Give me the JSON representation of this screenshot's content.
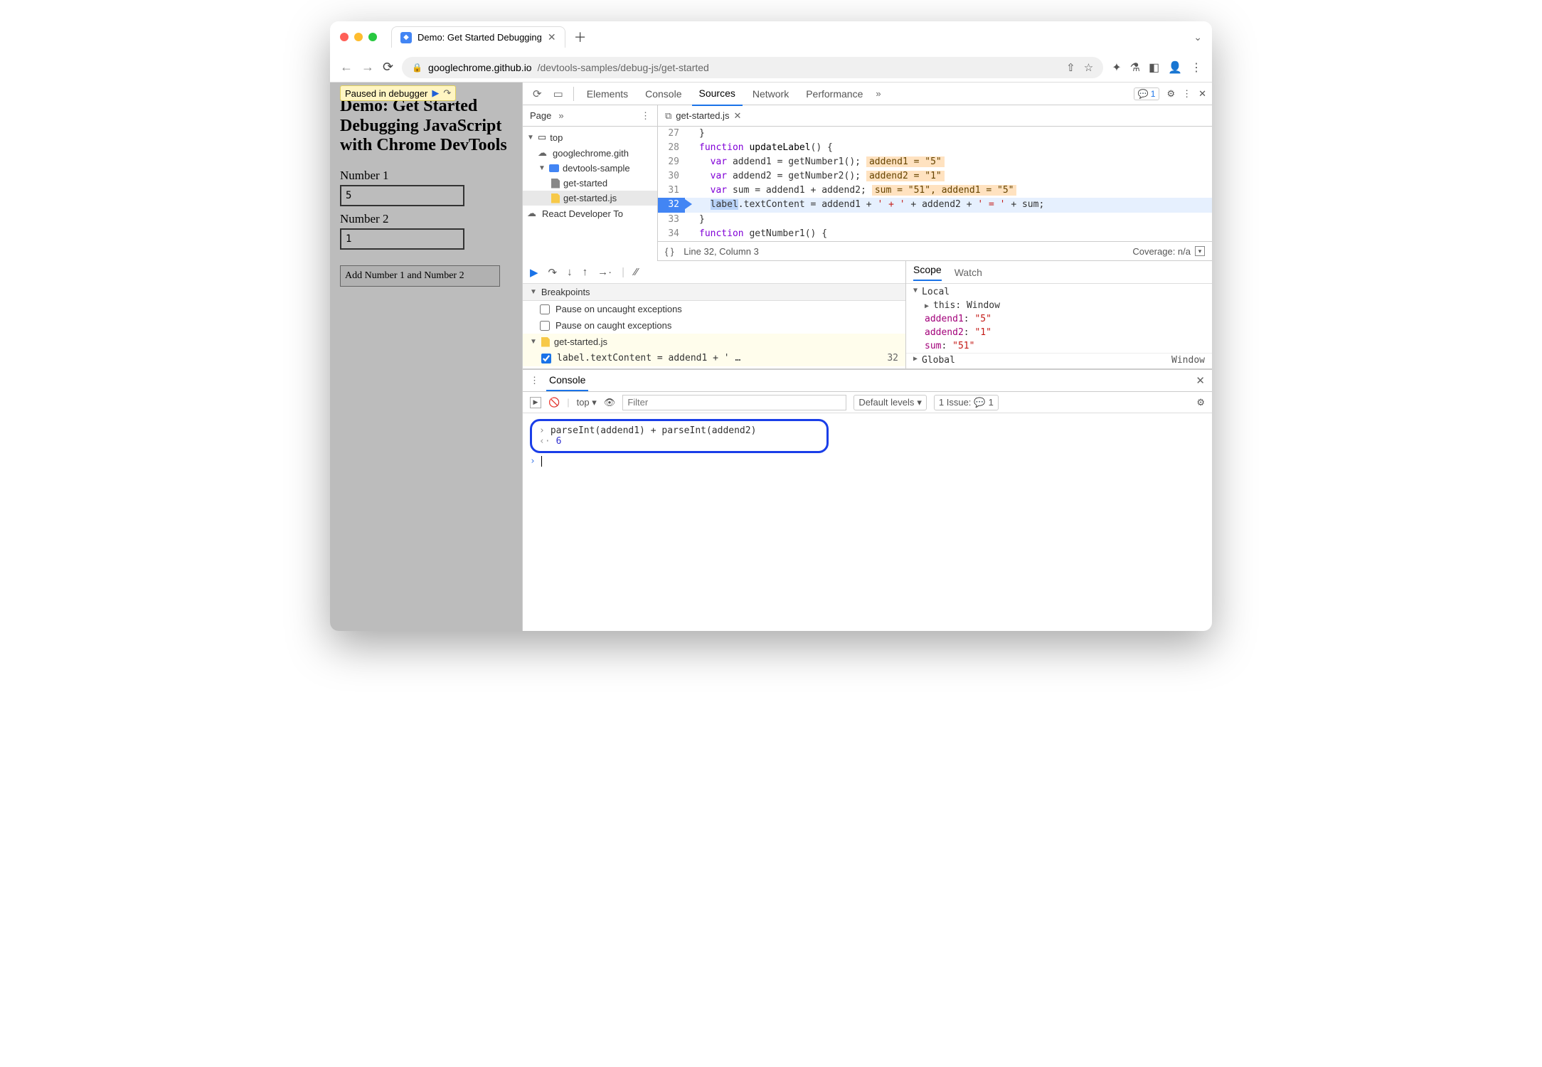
{
  "browser": {
    "tab_title": "Demo: Get Started Debugging",
    "url_domain": "googlechrome.github.io",
    "url_path": "/devtools-samples/debug-js/get-started"
  },
  "page": {
    "paused_label": "Paused in debugger",
    "heading": "Demo: Get Started Debugging JavaScript with Chrome DevTools",
    "label1": "Number 1",
    "value1": "5",
    "label2": "Number 2",
    "value2": "1",
    "button": "Add Number 1 and Number 2"
  },
  "devtools": {
    "tabs": {
      "elements": "Elements",
      "console": "Console",
      "sources": "Sources",
      "network": "Network",
      "performance": "Performance"
    },
    "issues_count": "1",
    "nav": {
      "page": "Page"
    },
    "open_file": "get-started.js",
    "tree": {
      "top": "top",
      "origin": "googlechrome.gith",
      "folder": "devtools-sample",
      "file_html": "get-started",
      "file_js": "get-started.js",
      "react": "React Developer To"
    },
    "code": {
      "lines": [
        {
          "n": "27",
          "raw": "}"
        },
        {
          "n": "28",
          "raw": "function updateLabel() {"
        },
        {
          "n": "29",
          "raw": "  var addend1 = getNumber1();",
          "hint": "addend1 = \"5\""
        },
        {
          "n": "30",
          "raw": "  var addend2 = getNumber2();",
          "hint": "addend2 = \"1\""
        },
        {
          "n": "31",
          "raw": "  var sum = addend1 + addend2;",
          "hint": "sum = \"51\", addend1 = \"5\""
        },
        {
          "n": "32",
          "raw": "  label.textContent = addend1 + ' + ' + addend2 + ' = ' + sum;"
        },
        {
          "n": "33",
          "raw": "}"
        },
        {
          "n": "34",
          "raw": "function getNumber1() {"
        }
      ],
      "status": "Line 32, Column 3",
      "coverage": "Coverage: n/a"
    },
    "breakpoints": {
      "header": "Breakpoints",
      "uncaught": "Pause on uncaught exceptions",
      "caught": "Pause on caught exceptions",
      "file": "get-started.js",
      "bp_text": "label.textContent = addend1 + ' …",
      "bp_line": "32"
    },
    "scope": {
      "tab_scope": "Scope",
      "tab_watch": "Watch",
      "local": "Local",
      "this_k": "this",
      "this_v": "Window",
      "a1_k": "addend1",
      "a1_v": "\"5\"",
      "a2_k": "addend2",
      "a2_v": "\"1\"",
      "sum_k": "sum",
      "sum_v": "\"51\"",
      "global": "Global",
      "global_v": "Window"
    },
    "drawer": {
      "tab": "Console",
      "top": "top",
      "filter_ph": "Filter",
      "levels": "Default levels",
      "issue_label": "1 Issue:",
      "issue_count": "1",
      "input": "parseInt(addend1) + parseInt(addend2)",
      "result": "6"
    }
  }
}
